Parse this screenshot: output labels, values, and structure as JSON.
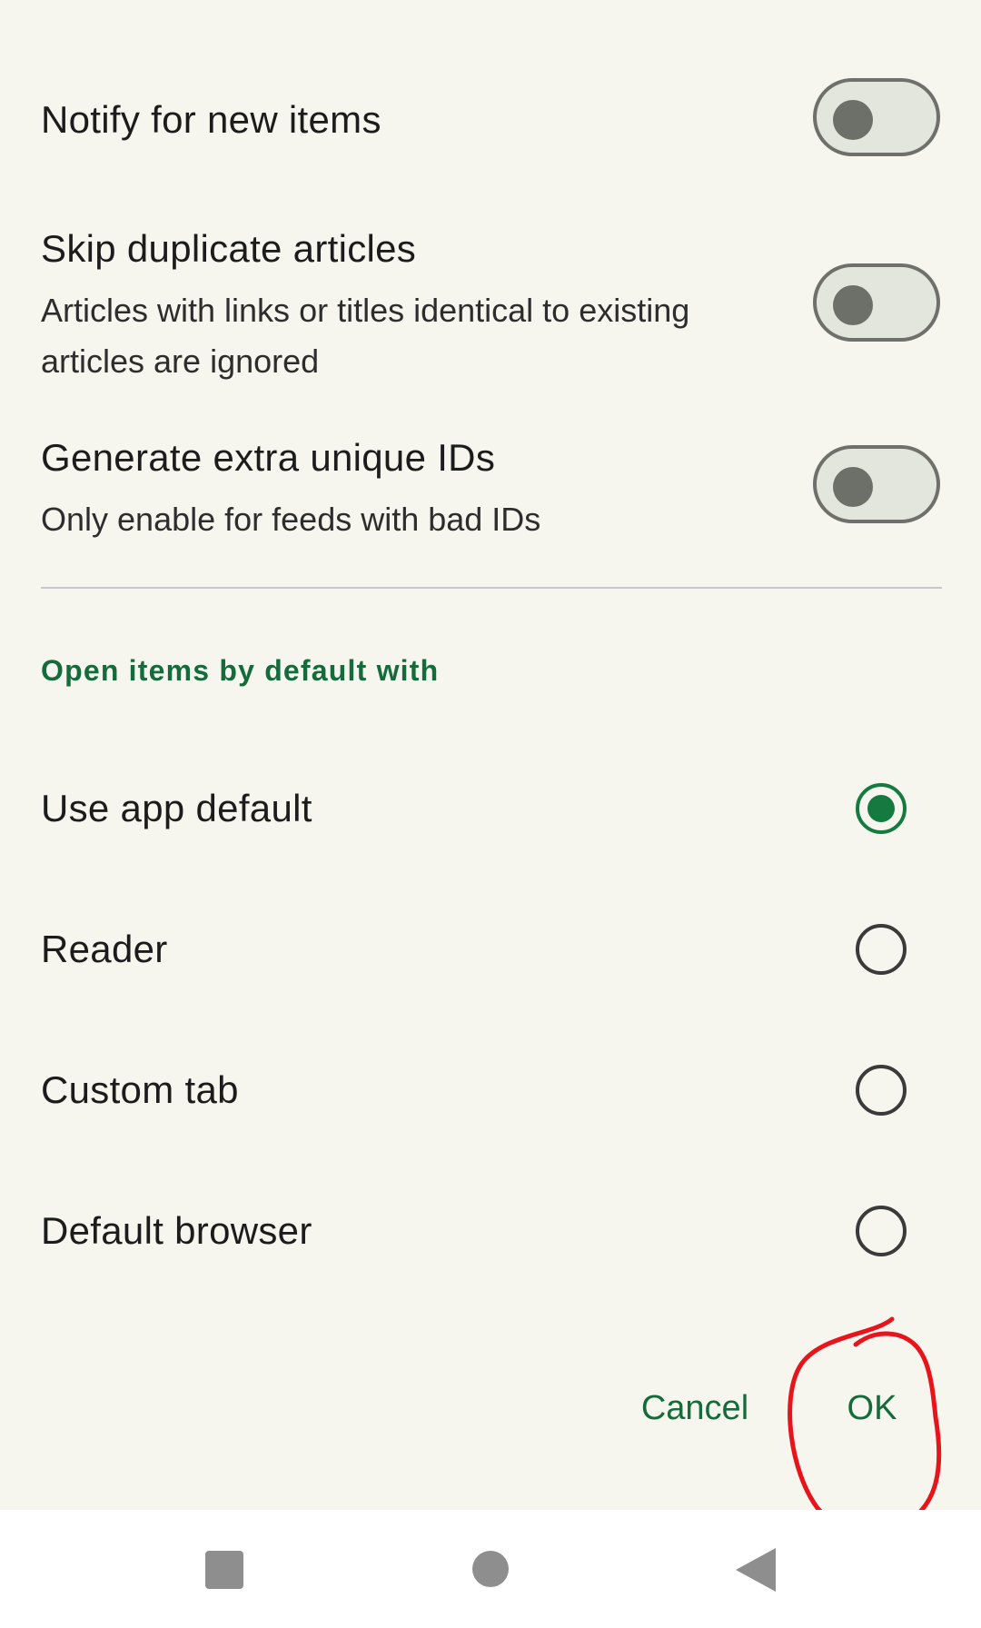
{
  "settings": {
    "notify": {
      "title": "Notify for new items",
      "enabled": false
    },
    "skip_duplicates": {
      "title": "Skip duplicate articles",
      "subtitle": "Articles with links or titles identical to existing articles are ignored",
      "enabled": false
    },
    "extra_ids": {
      "title": "Generate extra unique IDs",
      "subtitle": "Only enable for feeds with bad IDs",
      "enabled": false
    }
  },
  "open_with": {
    "header": "Open items by default with",
    "options": [
      {
        "label": "Use app default",
        "selected": true
      },
      {
        "label": "Reader",
        "selected": false
      },
      {
        "label": "Custom tab",
        "selected": false
      },
      {
        "label": "Default browser",
        "selected": false
      }
    ]
  },
  "dialog": {
    "cancel_label": "Cancel",
    "ok_label": "OK"
  },
  "annotation": {
    "color": "#e8141c",
    "shape": "hand-drawn circle around OK button"
  },
  "navbar": {
    "icons": [
      "recents-square-icon",
      "home-circle-icon",
      "back-triangle-icon"
    ]
  },
  "colors": {
    "accent": "#157a3f",
    "background": "#f6f6ef",
    "toggle_track": "#e3e6dc",
    "toggle_thumb": "#6d6f69"
  }
}
